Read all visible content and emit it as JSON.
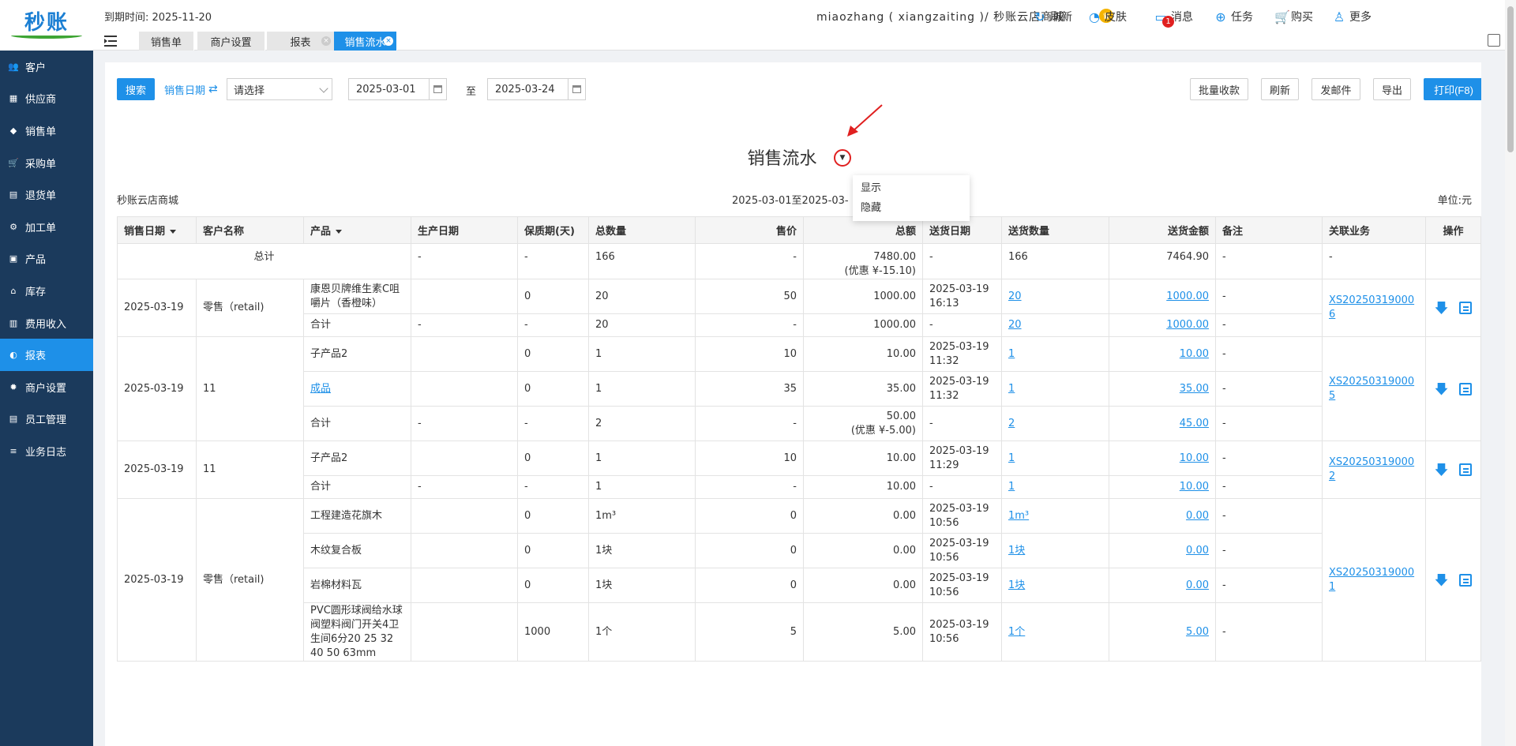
{
  "app": {
    "logo_text": "秒账",
    "expire_label": "到期时间: 2025-11-20",
    "user_info": "miaozhang ( xiangzaiting )/ 秒账云店商城"
  },
  "header_buttons": [
    {
      "label": "刷新",
      "icon": "refresh-icon"
    },
    {
      "label": "皮肤",
      "icon": "palette-icon"
    },
    {
      "label": "消息",
      "icon": "message-icon",
      "badge": "1"
    },
    {
      "label": "任务",
      "icon": "download-icon"
    },
    {
      "label": "购买",
      "icon": "cart-icon"
    },
    {
      "label": "更多",
      "icon": "user-icon"
    }
  ],
  "sidebar": {
    "items": [
      {
        "label": "客户",
        "icon": "users-icon"
      },
      {
        "label": "供应商",
        "icon": "supplier-icon"
      },
      {
        "label": "销售单",
        "icon": "tag-icon"
      },
      {
        "label": "采购单",
        "icon": "cart-icon"
      },
      {
        "label": "退货单",
        "icon": "return-icon"
      },
      {
        "label": "加工单",
        "icon": "process-icon"
      },
      {
        "label": "产品",
        "icon": "box-icon"
      },
      {
        "label": "库存",
        "icon": "warehouse-icon"
      },
      {
        "label": "费用收入",
        "icon": "money-icon"
      },
      {
        "label": "报表",
        "icon": "chart-icon",
        "active": true
      },
      {
        "label": "商户设置",
        "icon": "gear-icon"
      },
      {
        "label": "员工管理",
        "icon": "staff-icon"
      },
      {
        "label": "业务日志",
        "icon": "log-icon"
      }
    ]
  },
  "tabs": [
    {
      "label": "销售单"
    },
    {
      "label": "商户设置"
    },
    {
      "label": "报表",
      "closable": true
    },
    {
      "label": "销售流水",
      "closable": true,
      "active": true
    }
  ],
  "toolbar": {
    "search_label": "搜索",
    "date_type_label": "销售日期",
    "swap_icon": "⇄",
    "select_placeholder": "请选择",
    "start_date": "2025-03-01",
    "to_label": "至",
    "end_date": "2025-03-24",
    "batch_collect_label": "批量收款",
    "refresh_label": "刷新",
    "send_email_label": "发邮件",
    "export_label": "导出",
    "print_label": "打印(F8)"
  },
  "report": {
    "title": "销售流水",
    "shop": "秒账云店商城",
    "date_range": "2025-03-01至2025-03-",
    "unit": "单位:元",
    "dropdown_options": [
      "显示",
      "隐藏"
    ]
  },
  "table": {
    "headers": [
      "销售日期",
      "客户名称",
      "产品",
      "生产日期",
      "保质期(天)",
      "总数量",
      "售价",
      "总额",
      "送货日期",
      "送货数量",
      "送货金额",
      "备注",
      "关联业务",
      "操作"
    ],
    "total": {
      "label": "总计",
      "production_date": "-",
      "shelf_life": "-",
      "qty": "166",
      "price": "-",
      "amount": "7480.00",
      "discount": "(优惠 ¥-15.10)",
      "delivery_date": "-",
      "delivery_qty": "166",
      "delivery_amount": "7464.90",
      "remark": "-",
      "related": "-"
    },
    "groups": [
      {
        "date": "2025-03-19",
        "customer": "零售（retail)",
        "related": "XS20250319000 6",
        "items": [
          {
            "product": "康恩贝牌维生素C咀嚼片（香橙味）",
            "product_link": false,
            "production_date": "",
            "shelf_life": "0",
            "qty": "20",
            "price": "50",
            "amount": "1000.00",
            "discount": "",
            "delivery_date": "2025-03-19 16:13",
            "delivery_qty": "20",
            "delivery_amount": "1000.00",
            "remark": "-"
          }
        ],
        "subtotal": {
          "label": "合计",
          "production_date": "-",
          "shelf_life": "-",
          "qty": "20",
          "price": "-",
          "amount": "1000.00",
          "discount": "",
          "delivery_date": "-",
          "delivery_qty": "20",
          "delivery_amount": "1000.00",
          "remark": "-"
        }
      },
      {
        "date": "2025-03-19",
        "customer": "11",
        "related": "XS20250319000 5",
        "items": [
          {
            "product": "子产品2",
            "product_link": false,
            "production_date": "",
            "shelf_life": "0",
            "qty": "1",
            "price": "10",
            "amount": "10.00",
            "discount": "",
            "delivery_date": "2025-03-19 11:32",
            "delivery_qty": "1",
            "delivery_amount": "10.00",
            "remark": "-"
          },
          {
            "product": "成品",
            "product_link": true,
            "production_date": "",
            "shelf_life": "0",
            "qty": "1",
            "price": "35",
            "amount": "35.00",
            "discount": "",
            "delivery_date": "2025-03-19 11:32",
            "delivery_qty": "1",
            "delivery_amount": "35.00",
            "remark": "-"
          }
        ],
        "subtotal": {
          "label": "合计",
          "production_date": "-",
          "shelf_life": "-",
          "qty": "2",
          "price": "-",
          "amount": "50.00",
          "discount": "(优惠 ¥-5.00)",
          "delivery_date": "-",
          "delivery_qty": "2",
          "delivery_amount": "45.00",
          "remark": "-"
        }
      },
      {
        "date": "2025-03-19",
        "customer": "11",
        "related": "XS20250319000 2",
        "items": [
          {
            "product": "子产品2",
            "product_link": false,
            "production_date": "",
            "shelf_life": "0",
            "qty": "1",
            "price": "10",
            "amount": "10.00",
            "discount": "",
            "delivery_date": "2025-03-19 11:29",
            "delivery_qty": "1",
            "delivery_amount": "10.00",
            "remark": "-"
          }
        ],
        "subtotal": {
          "label": "合计",
          "production_date": "-",
          "shelf_life": "-",
          "qty": "1",
          "price": "-",
          "amount": "10.00",
          "discount": "",
          "delivery_date": "-",
          "delivery_qty": "1",
          "delivery_amount": "10.00",
          "remark": "-"
        }
      },
      {
        "date": "2025-03-19",
        "customer": "零售（retail)",
        "related": "XS20250319000 1",
        "items": [
          {
            "product": "工程建造花旗木",
            "product_link": false,
            "production_date": "",
            "shelf_life": "0",
            "qty": "1m³",
            "price": "0",
            "amount": "0.00",
            "discount": "",
            "delivery_date": "2025-03-19 10:56",
            "delivery_qty": "1m³",
            "delivery_amount": "0.00",
            "remark": "-"
          },
          {
            "product": "木纹复合板",
            "product_link": false,
            "production_date": "",
            "shelf_life": "0",
            "qty": "1块",
            "price": "0",
            "amount": "0.00",
            "discount": "",
            "delivery_date": "2025-03-19 10:56",
            "delivery_qty": "1块",
            "delivery_amount": "0.00",
            "remark": "-"
          },
          {
            "product": "岩棉材料瓦",
            "product_link": false,
            "production_date": "",
            "shelf_life": "0",
            "qty": "1块",
            "price": "0",
            "amount": "0.00",
            "discount": "",
            "delivery_date": "2025-03-19 10:56",
            "delivery_qty": "1块",
            "delivery_amount": "0.00",
            "remark": "-"
          },
          {
            "product": "PVC圆形球阀给水球阀塑料阀门开关4卫生间6分20 25 32 40 50 63mm",
            "product_link": false,
            "production_date": "",
            "shelf_life": "1000",
            "qty": "1个",
            "price": "5",
            "amount": "5.00",
            "discount": "",
            "delivery_date": "2025-03-19 10:56",
            "delivery_qty": "1个",
            "delivery_amount": "5.00",
            "remark": "-"
          }
        ],
        "subtotal": null
      }
    ]
  },
  "colors": {
    "sidebar": "#1b3a5c",
    "accent": "#1e90e8",
    "badge": "#e02020"
  }
}
